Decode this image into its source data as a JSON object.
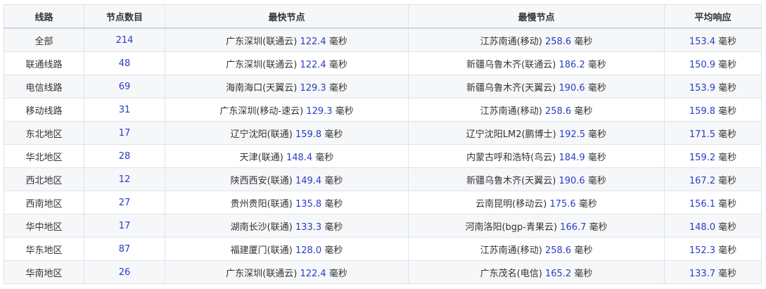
{
  "table": {
    "headers": {
      "route": "线路",
      "count": "节点数目",
      "fastest": "最快节点",
      "slowest": "最慢节点",
      "average": "平均响应"
    },
    "unit": "毫秒",
    "rows": [
      {
        "route": "全部",
        "count": "214",
        "fast_name": "广东深圳(联通云)",
        "fast_ms": "122.4",
        "slow_name": "江苏南通(移动)",
        "slow_ms": "258.6",
        "avg_ms": "153.4"
      },
      {
        "route": "联通线路",
        "count": "48",
        "fast_name": "广东深圳(联通云)",
        "fast_ms": "122.4",
        "slow_name": "新疆乌鲁木齐(联通云)",
        "slow_ms": "186.2",
        "avg_ms": "150.9"
      },
      {
        "route": "电信线路",
        "count": "69",
        "fast_name": "海南海口(天翼云)",
        "fast_ms": "129.3",
        "slow_name": "新疆乌鲁木齐(天翼云)",
        "slow_ms": "190.6",
        "avg_ms": "153.9"
      },
      {
        "route": "移动线路",
        "count": "31",
        "fast_name": "广东深圳(移动-速云)",
        "fast_ms": "129.3",
        "slow_name": "江苏南通(移动)",
        "slow_ms": "258.6",
        "avg_ms": "159.8"
      },
      {
        "route": "东北地区",
        "count": "17",
        "fast_name": "辽宁沈阳(联通)",
        "fast_ms": "159.8",
        "slow_name": "辽宁沈阳LM2(鹏博士)",
        "slow_ms": "192.5",
        "avg_ms": "171.5"
      },
      {
        "route": "华北地区",
        "count": "28",
        "fast_name": "天津(联通)",
        "fast_ms": "148.4",
        "slow_name": "内蒙古呼和浩特(鸟云)",
        "slow_ms": "184.9",
        "avg_ms": "159.2"
      },
      {
        "route": "西北地区",
        "count": "12",
        "fast_name": "陕西西安(联通)",
        "fast_ms": "149.4",
        "slow_name": "新疆乌鲁木齐(天翼云)",
        "slow_ms": "190.6",
        "avg_ms": "167.2"
      },
      {
        "route": "西南地区",
        "count": "27",
        "fast_name": "贵州贵阳(联通)",
        "fast_ms": "135.8",
        "slow_name": "云南昆明(移动云)",
        "slow_ms": "175.6",
        "avg_ms": "156.1"
      },
      {
        "route": "华中地区",
        "count": "17",
        "fast_name": "湖南长沙(联通)",
        "fast_ms": "133.3",
        "slow_name": "河南洛阳(bgp-青果云)",
        "slow_ms": "166.7",
        "avg_ms": "148.0"
      },
      {
        "route": "华东地区",
        "count": "87",
        "fast_name": "福建厦门(联通)",
        "fast_ms": "128.0",
        "slow_name": "江苏南通(移动)",
        "slow_ms": "258.6",
        "avg_ms": "152.3"
      },
      {
        "route": "华南地区",
        "count": "26",
        "fast_name": "广东深圳(联通云)",
        "fast_ms": "122.4",
        "slow_name": "广东茂名(电信)",
        "slow_ms": "165.2",
        "avg_ms": "133.7"
      }
    ]
  },
  "colors": {
    "number_accent": "#2a3cc8",
    "text": "#333333",
    "border": "#dfe3ea",
    "stripe": "#f6f7f9"
  }
}
